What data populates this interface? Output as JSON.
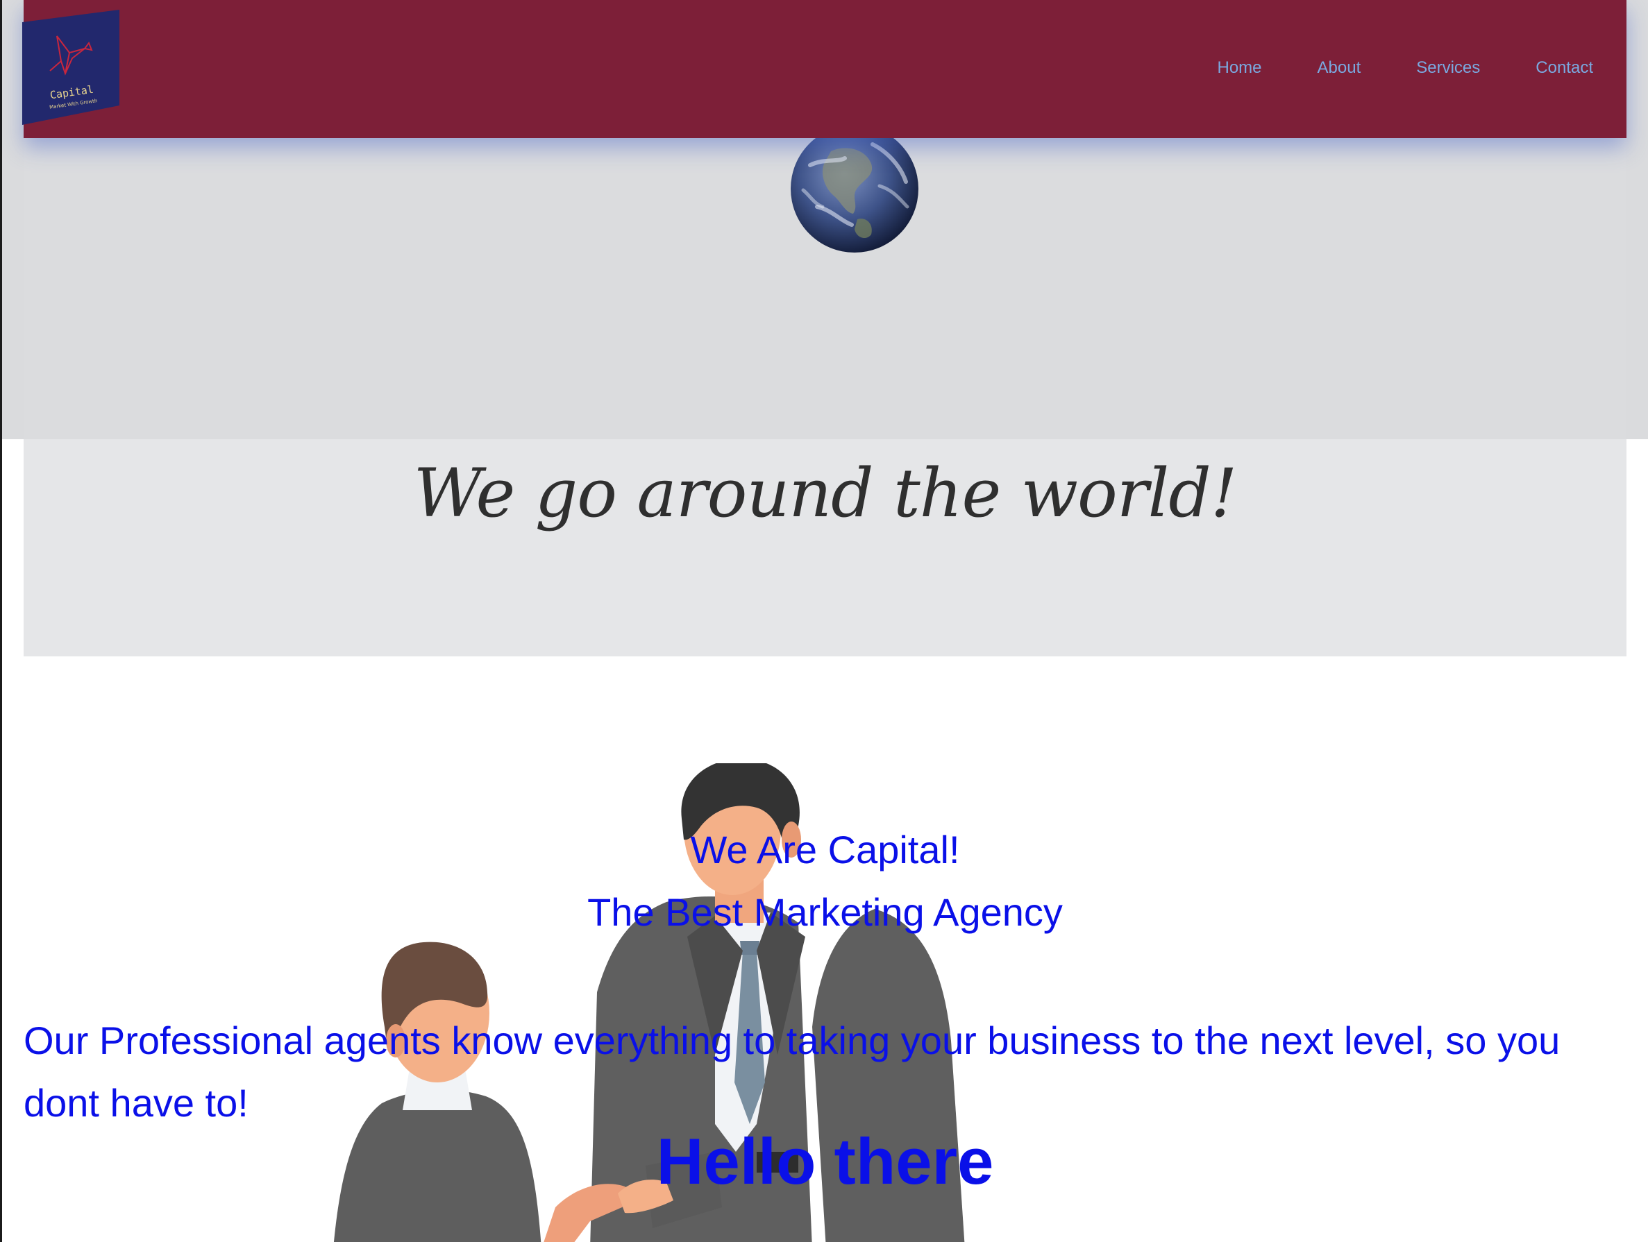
{
  "brand": {
    "name": "Capital",
    "slogan": "Market With Growth"
  },
  "nav": {
    "items": [
      "Home",
      "About",
      "Services",
      "Contact"
    ]
  },
  "hero": {
    "tagline": "We go around the world!"
  },
  "intro": {
    "line1": "We Are Capital!",
    "line2": "The Best Marketing Agency",
    "paragraph": "Our Professional agents know everything to taking your business to the next level, so you dont have to!",
    "greeting": "Hello there"
  },
  "colors": {
    "header": "#7d1f38",
    "nav_link": "#7aa9e0",
    "text_blue": "#0a10e8",
    "logo_bg": "#22286d"
  }
}
